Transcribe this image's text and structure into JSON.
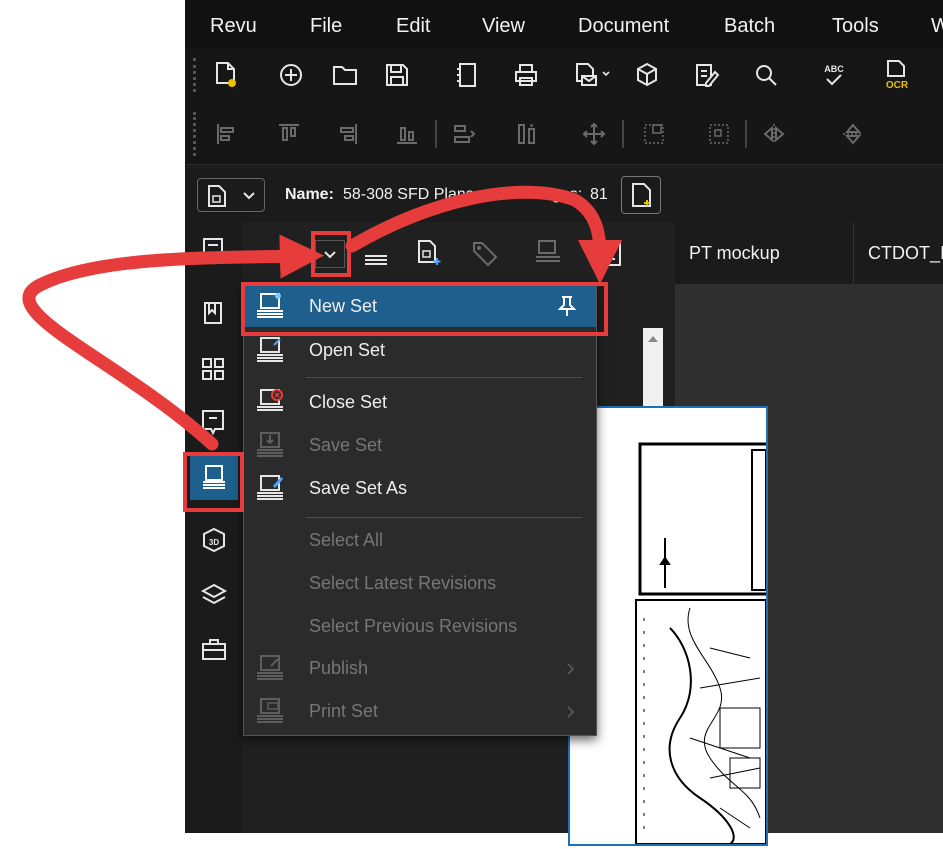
{
  "menubar": {
    "items": [
      "Revu",
      "File",
      "Edit",
      "View",
      "Document",
      "Batch",
      "Tools",
      "W"
    ]
  },
  "namebar": {
    "name_label": "Name:",
    "name_value": "58-308 SFD Plans",
    "pages_fragment": "ages:",
    "pages_count": "81"
  },
  "panel": {
    "title_fragment": "s"
  },
  "tabs": {
    "items": [
      "PT mockup",
      "CTDOT_I"
    ]
  },
  "dropdown": {
    "items": [
      {
        "label": "New Set",
        "enabled": true,
        "highlighted": true,
        "pin": true
      },
      {
        "label": "Open Set",
        "enabled": true
      },
      {
        "label": "Close Set",
        "enabled": true
      },
      {
        "label": "Save Set",
        "enabled": false
      },
      {
        "label": "Save Set As",
        "enabled": true
      },
      {
        "label": "Select All",
        "enabled": false
      },
      {
        "label": "Select Latest Revisions",
        "enabled": false
      },
      {
        "label": "Select Previous Revisions",
        "enabled": false
      },
      {
        "label": "Publish",
        "enabled": false,
        "submenu": true
      },
      {
        "label": "Print Set",
        "enabled": false,
        "submenu": true
      }
    ]
  },
  "toolbar_icons": {
    "row1": [
      "new-document-icon",
      "add-circle-icon",
      "open-folder-icon",
      "save-icon",
      "notebook-icon",
      "print-icon",
      "email-icon",
      "package-icon",
      "edit-document-icon",
      "search-icon",
      "spellcheck-icon",
      "ocr-icon"
    ],
    "row2": [
      "align-left-icon",
      "align-top-icon",
      "align-right-icon",
      "align-bottom-icon",
      "distribute-horizontal-icon",
      "distribute-vertical-icon",
      "center-icon",
      "grid-icon",
      "snap-icon",
      "flip-horizontal-icon",
      "flip-vertical-icon"
    ],
    "spellcheck_text": "ABC",
    "ocr_text": "OCR"
  },
  "annotation": {
    "highlight_color": "#e63c3c",
    "selected_color": "#1f5f8e"
  }
}
